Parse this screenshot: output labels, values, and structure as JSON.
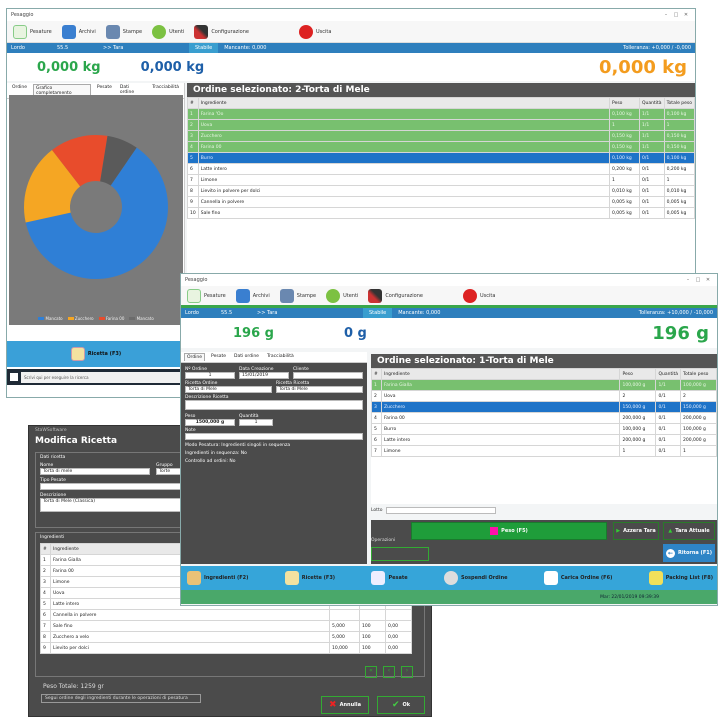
{
  "w1": {
    "title": "Pesaggio",
    "controls": [
      "–",
      "□",
      "✕"
    ],
    "toolbar": [
      {
        "label": "Pesature",
        "icon": "scale-icon"
      },
      {
        "label": "Archivi",
        "icon": "archive-icon"
      },
      {
        "label": "Stampe",
        "icon": "printer-icon"
      },
      {
        "label": "Utenti",
        "icon": "users-icon"
      },
      {
        "label": "Configurazione",
        "icon": "tools-icon"
      },
      {
        "label": "Uscita",
        "icon": "exit-icon"
      }
    ],
    "status": {
      "left": "Lordo",
      "mid": "55.5",
      "tare": ">> Tara",
      "stable": "Stabile",
      "mark": "Mancante: 0,000",
      "tol": "Tolleranza: +0,000 / -0,000"
    },
    "weight_a": "0,000 kg",
    "weight_b": "0,000 kg",
    "weight_big": "0,000 kg",
    "tabs": [
      "Ordine",
      "Grafico completamento",
      "Pesate",
      "Dati ordine",
      "Tracciabilità"
    ],
    "order_title": "Ordine selezionato: 2-Torta di Mele",
    "columns": [
      "#",
      "Ingrediente",
      "Peso",
      "Quantità",
      "Totale peso"
    ],
    "rows": [
      {
        "n": "1",
        "name": "Farina 'Oo",
        "peso": "0,100 kg",
        "q": "1/1",
        "tot": "0,100 kg",
        "st": "g"
      },
      {
        "n": "2",
        "name": "Uova",
        "peso": "1",
        "q": "1/1",
        "tot": "1",
        "st": "g"
      },
      {
        "n": "3",
        "name": "Zucchero",
        "peso": "0,150 kg",
        "q": "1/1",
        "tot": "0,150 kg",
        "st": "g"
      },
      {
        "n": "4",
        "name": "Farina 00",
        "peso": "0,150 kg",
        "q": "1/1",
        "tot": "0,150 kg",
        "st": "g"
      },
      {
        "n": "5",
        "name": "Burro",
        "peso": "0,100 kg",
        "q": "0/1",
        "tot": "0,100 kg",
        "st": "b"
      },
      {
        "n": "6",
        "name": "Latte intero",
        "peso": "0,200 kg",
        "q": "0/1",
        "tot": "0,200 kg",
        "st": ""
      },
      {
        "n": "7",
        "name": "Limone",
        "peso": "1",
        "q": "0/1",
        "tot": "1",
        "st": ""
      },
      {
        "n": "8",
        "name": "Lievito in polvere per dolci",
        "peso": "0,010 kg",
        "q": "0/1",
        "tot": "0,010 kg",
        "st": ""
      },
      {
        "n": "9",
        "name": "Cannella in polvere",
        "peso": "0,005 kg",
        "q": "0/1",
        "tot": "0,005 kg",
        "st": ""
      },
      {
        "n": "10",
        "name": "Sale fino",
        "peso": "0,005 kg",
        "q": "0/1",
        "tot": "0,005 kg",
        "st": ""
      }
    ],
    "legend": [
      "Mancato",
      "Zucchero",
      "Farina 00",
      "Mancato"
    ],
    "legend_colors": [
      "#2f7fd6",
      "#f5a623",
      "#e84c2c",
      "#6b6b6b"
    ],
    "chart_data": {
      "type": "pie",
      "values": [
        62,
        18,
        13,
        7
      ],
      "colors": [
        "#2f7fd6",
        "#f5a623",
        "#e84c2c",
        "#5a5a5a"
      ]
    },
    "recipe_btn": "Ricetta (F3)",
    "taskbar_search": "Scrivi qui per eseguire la ricerca"
  },
  "w2": {
    "title": "Pesaggio",
    "toolbar": [
      {
        "label": "Pesature",
        "icon": "scale-icon"
      },
      {
        "label": "Archivi",
        "icon": "archive-icon"
      },
      {
        "label": "Stampe",
        "icon": "printer-icon"
      },
      {
        "label": "Utenti",
        "icon": "users-icon"
      },
      {
        "label": "Configurazione",
        "icon": "tools-icon"
      },
      {
        "label": "Uscita",
        "icon": "exit-icon"
      }
    ],
    "status": {
      "left": "Lordo",
      "mid": "55.5",
      "tare": ">> Tara",
      "stable": "Stabile",
      "mark": "Mancante: 0,000",
      "tol": "Tolleranza: +10,000 / -10,000"
    },
    "weight_a": "196 g",
    "weight_b": "0 g",
    "weight_big": "196 g",
    "tabs": [
      "Ordine",
      "Pesate",
      "Dati ordine",
      "Tracciabilità"
    ],
    "order_title": "Ordine selezionato: 1-Torta di Mele",
    "columns": [
      "#",
      "Ingrediente",
      "Peso",
      "Quantità",
      "Totale peso"
    ],
    "rows": [
      {
        "n": "1",
        "name": "Farina Gialla",
        "peso": "100,000 g",
        "q": "1/1",
        "tot": "100,000 g",
        "st": "g"
      },
      {
        "n": "2",
        "name": "Uova",
        "peso": "2",
        "q": "0/1",
        "tot": "2",
        "st": ""
      },
      {
        "n": "3",
        "name": "Zucchero",
        "peso": "150,000 g",
        "q": "0/1",
        "tot": "150,000 g",
        "st": "b"
      },
      {
        "n": "4",
        "name": "Farina 00",
        "peso": "200,000 g",
        "q": "0/1",
        "tot": "200,000 g",
        "st": ""
      },
      {
        "n": "5",
        "name": "Burro",
        "peso": "100,000 g",
        "q": "0/1",
        "tot": "100,000 g",
        "st": ""
      },
      {
        "n": "6",
        "name": "Latte intero",
        "peso": "200,000 g",
        "q": "0/1",
        "tot": "200,000 g",
        "st": ""
      },
      {
        "n": "7",
        "name": "Limone",
        "peso": "1",
        "q": "0/1",
        "tot": "1",
        "st": ""
      }
    ],
    "order_form": {
      "f1_label": "Nº Ordine",
      "f1": "1",
      "f2_label": "Data Creazione",
      "f2": "15/01/2019",
      "f3_label": "Cliente",
      "f3": "",
      "f4_label": "Ricetta Ordine",
      "f4": "Torta di Mele",
      "f5_label": "Ricetta Ricetta",
      "f5": "Torta di Mele",
      "f6_label": "Descrizione Ricetta",
      "f6": "",
      "f7_label": "Peso",
      "f7": "1500,000 g",
      "f8_label": "Quantità",
      "f8": "1",
      "f9_label": "Note",
      "f9": "",
      "mode": "Modo Pesatura:  Ingredienti singoli in sequenza",
      "seq": "Ingredienti in sequenza:  No",
      "ctrl": "Controllo ad ordini:  No"
    },
    "lotto_label": "Lotto",
    "lotto_field_label": "Operazioni",
    "peso_btn": "Peso (F5)",
    "azzera_btn": "Azzera Tara",
    "tara_btn": "Tara Attuale",
    "back_btn": "Ritorna (F1)",
    "bottom": [
      {
        "label": "Ingredienti (F2)",
        "icon": "ingredients-icon"
      },
      {
        "label": "Ricette (F3)",
        "icon": "recipes-icon"
      },
      {
        "label": "Pesate",
        "icon": "pen-icon"
      },
      {
        "label": "Sospendi Ordine",
        "icon": "suspend-icon"
      },
      {
        "label": "Carica Ordine (F6)",
        "icon": "load-order-icon"
      },
      {
        "label": "Packing List (F8)",
        "icon": "packing-icon"
      }
    ],
    "footer_date": "Mar: 22/01/2019 09:39:39"
  },
  "w3": {
    "app": "StaWSoftware",
    "title": "Modifica Ricetta",
    "section_data": "Dati ricetta",
    "name_label": "Nome",
    "name": "Torta di mele",
    "group_label": "Gruppo",
    "group": "Torte",
    "type_label": "Tipo Pesate",
    "type": "",
    "desc_label": "Descrizione",
    "desc": "Torta di Mele (Classica)",
    "section_ing": "Ingredienti",
    "cols": [
      "#",
      "Ingrediente",
      "",
      "",
      ""
    ],
    "rows": [
      {
        "n": "1",
        "name": "Farina Gialla",
        "a": "",
        "b": "",
        "c": ""
      },
      {
        "n": "2",
        "name": "Farina 00",
        "a": "",
        "b": "",
        "c": ""
      },
      {
        "n": "3",
        "name": "Limone",
        "a": "",
        "b": "",
        "c": ""
      },
      {
        "n": "4",
        "name": "Uova",
        "a": "",
        "b": "",
        "c": ""
      },
      {
        "n": "5",
        "name": "Latte intero",
        "a": "",
        "b": "",
        "c": ""
      },
      {
        "n": "6",
        "name": "Cannella in polvere",
        "a": "",
        "b": "",
        "c": ""
      },
      {
        "n": "7",
        "name": "Sale fino",
        "a": "5,000",
        "b": "100",
        "c": "0,00"
      },
      {
        "n": "8",
        "name": "Zucchero a velo",
        "a": "5,000",
        "b": "100",
        "c": "0,00"
      },
      {
        "n": "9",
        "name": "Lievito per dolci",
        "a": "10,000",
        "b": "100",
        "c": "0,00"
      }
    ],
    "total": "Peso Totale:  1259 gr",
    "check": "Segui ordine degli ingredienti durante le operazioni di pesatura",
    "annulla": "Annulla",
    "ok": "Ok"
  }
}
